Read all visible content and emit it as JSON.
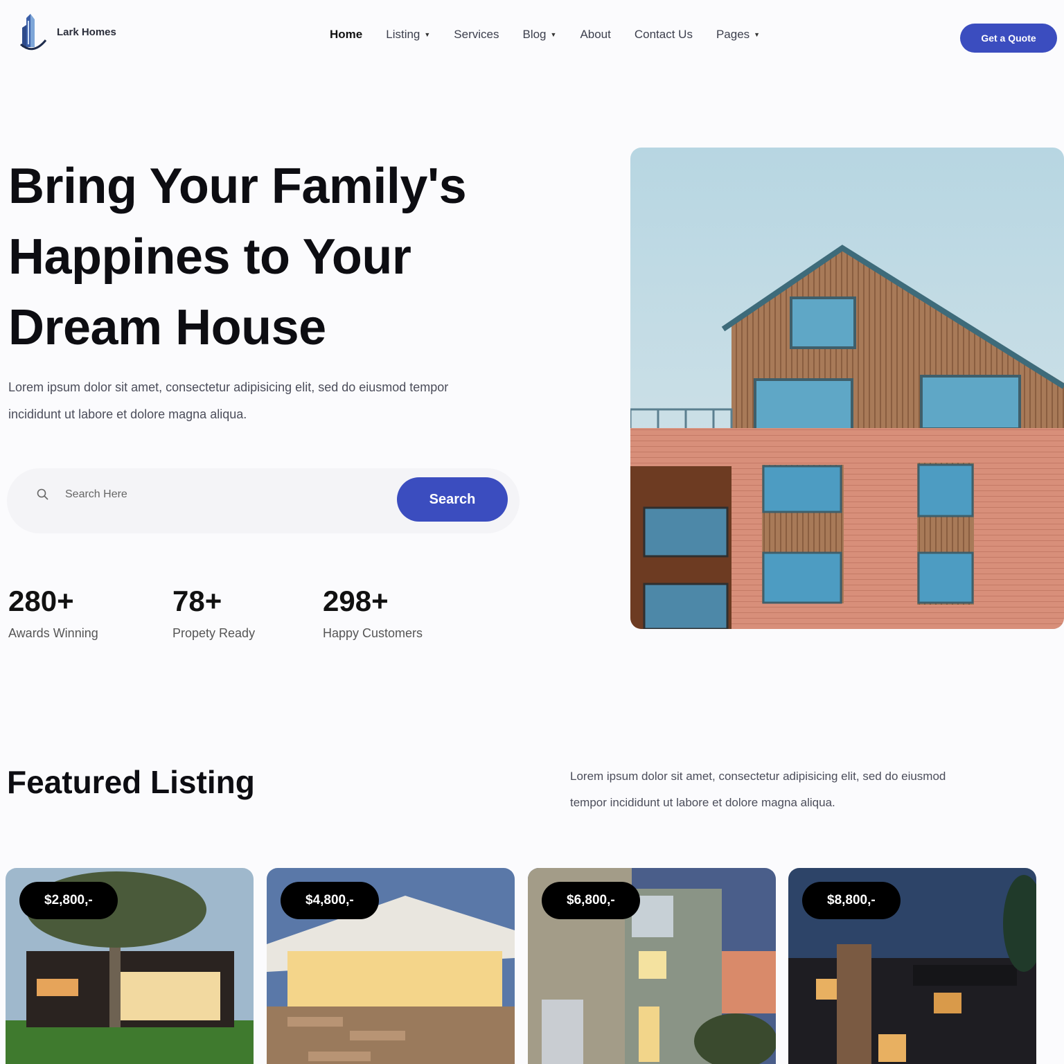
{
  "brand": {
    "name": "Lark Homes",
    "logo_icon": "building-logo-icon"
  },
  "nav": {
    "items": [
      {
        "label": "Home",
        "active": true,
        "dropdown": false
      },
      {
        "label": "Listing",
        "active": false,
        "dropdown": true
      },
      {
        "label": "Services",
        "active": false,
        "dropdown": false
      },
      {
        "label": "Blog",
        "active": false,
        "dropdown": true
      },
      {
        "label": "About",
        "active": false,
        "dropdown": false
      },
      {
        "label": "Contact Us",
        "active": false,
        "dropdown": false
      },
      {
        "label": "Pages",
        "active": false,
        "dropdown": true
      }
    ],
    "cta": "Get a Quote"
  },
  "hero": {
    "title_lines": [
      "Bring Your Family's",
      "Happines to Your",
      "Dream House"
    ],
    "description_lines": [
      "Lorem ipsum dolor sit amet, consectetur adipisicing elit, sed do eiusmod tempor",
      "incididunt ut labore et dolore magna aliqua."
    ],
    "search": {
      "placeholder": "Search Here",
      "button": "Search"
    },
    "stats": [
      {
        "value": "280+",
        "label": "Awards Winning"
      },
      {
        "value": "78+",
        "label": "Propety Ready"
      },
      {
        "value": "298+",
        "label": "Happy Customers"
      }
    ]
  },
  "featured": {
    "title": "Featured Listing",
    "description_lines": [
      "Lorem ipsum dolor sit amet, consectetur adipisicing elit, sed do eiusmod",
      "tempor incididunt ut labore et dolore magna aliqua."
    ],
    "listings": [
      {
        "price": "$2,800,-"
      },
      {
        "price": "$4,800,-"
      },
      {
        "price": "$6,800,-"
      },
      {
        "price": "$8,800,-"
      }
    ]
  },
  "colors": {
    "accent": "#3b4dbf",
    "text": "#0d0d12",
    "muted": "#4b4d5a",
    "background": "#fbfbfd"
  }
}
